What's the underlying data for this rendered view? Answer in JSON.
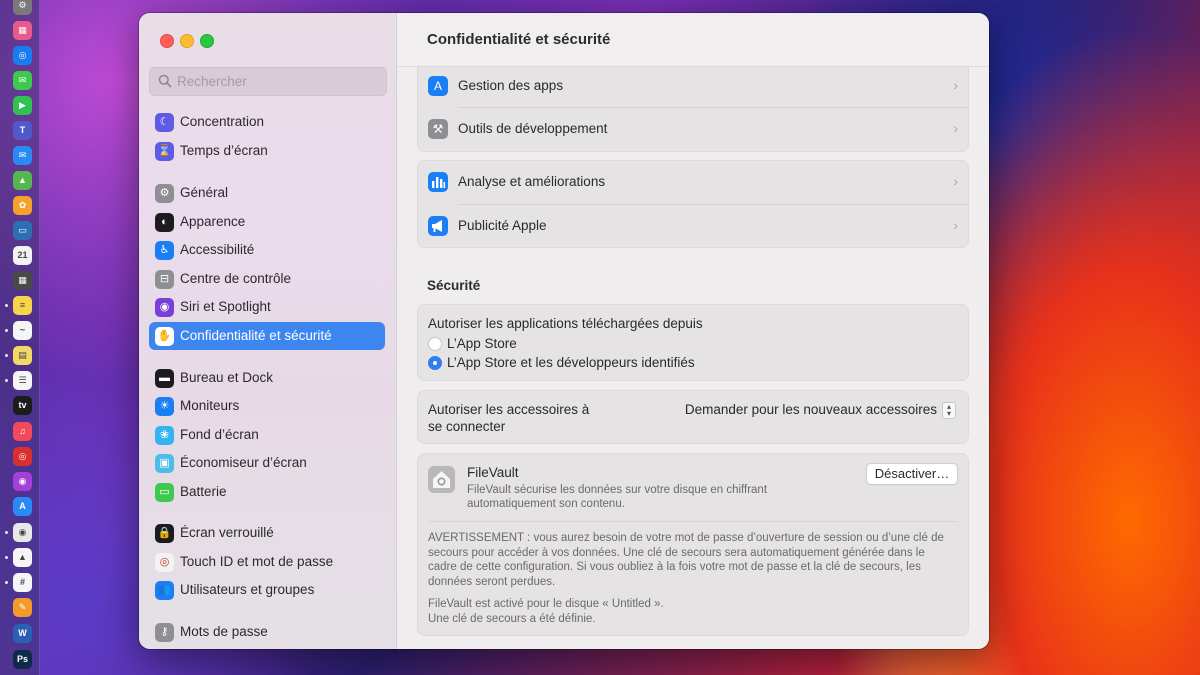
{
  "colors": {
    "accent": "#3d86f0",
    "close": "#ff5f57",
    "minimize": "#febc2e",
    "zoom": "#28c840"
  },
  "dock": {
    "icons": [
      {
        "name": "system-settings-icon",
        "glyph": "⚙",
        "color": "#7a7a7a"
      },
      {
        "name": "launchpad-icon",
        "glyph": "▦",
        "color": "#e85a8a"
      },
      {
        "name": "safari-icon",
        "glyph": "◎",
        "color": "#1b7cf2"
      },
      {
        "name": "messages-icon",
        "glyph": "✉",
        "color": "#3ec94e"
      },
      {
        "name": "facetime-icon",
        "glyph": "▶",
        "color": "#30c252"
      },
      {
        "name": "teams-icon",
        "glyph": "T",
        "color": "#5059c9"
      },
      {
        "name": "mail-icon",
        "glyph": "✉",
        "color": "#2a8af5"
      },
      {
        "name": "maps-icon",
        "glyph": "▲",
        "color": "#55b84f"
      },
      {
        "name": "photos-icon",
        "glyph": "✿",
        "color": "#f4a22b"
      },
      {
        "name": "preview-icon",
        "glyph": "▭",
        "color": "#2d6fb3"
      },
      {
        "name": "calendar-icon",
        "glyph": "21",
        "color": "#f2f2f2"
      },
      {
        "name": "calculator-icon",
        "glyph": "▦",
        "color": "#4a4a4a"
      },
      {
        "name": "notes-icon",
        "glyph": "≡",
        "color": "#f7d54a"
      },
      {
        "name": "freeform-icon",
        "glyph": "~",
        "color": "#f5f5f5"
      },
      {
        "name": "stickies-icon",
        "glyph": "▤",
        "color": "#f3d868"
      },
      {
        "name": "reminders-icon",
        "glyph": "☰",
        "color": "#f5f5f5"
      },
      {
        "name": "apple-tv-icon",
        "glyph": "tv",
        "color": "#1c1c1c"
      },
      {
        "name": "music-icon",
        "glyph": "♫",
        "color": "#f24a5c"
      },
      {
        "name": "creative-cloud-icon",
        "glyph": "◎",
        "color": "#da2f2f"
      },
      {
        "name": "podcasts-icon",
        "glyph": "◉",
        "color": "#a43fd8"
      },
      {
        "name": "app-store-icon",
        "glyph": "A",
        "color": "#2a8af5"
      },
      {
        "name": "chrome-icon",
        "glyph": "◉",
        "color": "#e8e8e8"
      },
      {
        "name": "google-drive-icon",
        "glyph": "▲",
        "color": "#f5f5f5"
      },
      {
        "name": "slack-icon",
        "glyph": "#",
        "color": "#f5f5f5"
      },
      {
        "name": "pages-icon",
        "glyph": "✎",
        "color": "#f39a2b"
      },
      {
        "name": "word-icon",
        "glyph": "W",
        "color": "#2b5fb4"
      },
      {
        "name": "photoshop-icon",
        "glyph": "Ps",
        "color": "#0f2a4a"
      }
    ]
  },
  "window": {
    "search_placeholder": "Rechercher",
    "title": "Confidentialité et sécurité"
  },
  "sidebar": {
    "items": [
      {
        "label": "Concentration",
        "icon": "moon-icon",
        "glyph": "☾",
        "color": "#5e5ce6"
      },
      {
        "label": "Temps d’écran",
        "icon": "hourglass-icon",
        "glyph": "⌛",
        "color": "#5e5ce6"
      },
      {
        "label": "Général",
        "icon": "gear-icon",
        "glyph": "⚙",
        "color": "#8e8e93"
      },
      {
        "label": "Apparence",
        "icon": "appearance-icon",
        "glyph": "◐",
        "color": "#1c1c1e"
      },
      {
        "label": "Accessibilité",
        "icon": "accessibility-icon",
        "glyph": "♿",
        "color": "#1a7ef5"
      },
      {
        "label": "Centre de contrôle",
        "icon": "control-center-icon",
        "glyph": "⊟",
        "color": "#8e8e93"
      },
      {
        "label": "Siri et Spotlight",
        "icon": "siri-icon",
        "glyph": "◉",
        "color": "#7a3fd8"
      },
      {
        "label": "Confidentialité et sécurité",
        "icon": "hand-icon",
        "glyph": "✋",
        "color": "#3d86f0"
      },
      {
        "label": "Bureau et Dock",
        "icon": "dock-icon",
        "glyph": "▬",
        "color": "#1c1c1e"
      },
      {
        "label": "Moniteurs",
        "icon": "brightness-icon",
        "glyph": "☀",
        "color": "#1a7ef5"
      },
      {
        "label": "Fond d’écran",
        "icon": "wallpaper-icon",
        "glyph": "❀",
        "color": "#33b3f0"
      },
      {
        "label": "Économiseur d’écran",
        "icon": "screensaver-icon",
        "glyph": "▣",
        "color": "#4bbde6"
      },
      {
        "label": "Batterie",
        "icon": "battery-icon",
        "glyph": "▭",
        "color": "#3ec94e"
      },
      {
        "label": "Écran verrouillé",
        "icon": "lock-icon",
        "glyph": "🔒",
        "color": "#1c1c1e"
      },
      {
        "label": "Touch ID et mot de passe",
        "icon": "fingerprint-icon",
        "glyph": "◎",
        "color": "#f2f2f2"
      },
      {
        "label": "Utilisateurs et groupes",
        "icon": "users-icon",
        "glyph": "👥",
        "color": "#1a7ef5"
      },
      {
        "label": "Mots de passe",
        "icon": "key-icon",
        "glyph": "⚷",
        "color": "#8e8e93"
      }
    ]
  },
  "main": {
    "group1": [
      {
        "label": "Gestion des apps",
        "icon": "app-store-icon",
        "glyph": "A",
        "color": "#1a7ef5"
      },
      {
        "label": "Outils de développement",
        "icon": "hammer-icon",
        "glyph": "⚒",
        "color": "#8e8e93"
      }
    ],
    "group2": [
      {
        "label": "Analyse et améliorations",
        "icon": "chart-icon",
        "glyph": "▮",
        "color": "#1a7ef5"
      },
      {
        "label": "Publicité Apple",
        "icon": "megaphone-icon",
        "glyph": "📢",
        "color": "#1a7ef5"
      }
    ],
    "security": {
      "section_title": "Sécurité",
      "download_label": "Autoriser les applications téléchargées depuis",
      "option1": "L’App Store",
      "option2": "L’App Store et les développeurs identifiés",
      "selected_option": "L’App Store et les développeurs identifiés",
      "accessories_label_line1": "Autoriser les accessoires à",
      "accessories_label_line2": "se connecter",
      "accessories_value": "Demander pour les nouveaux accessoires",
      "filevault_title": "FileVault",
      "filevault_desc_line1": "FileVault sécurise les données sur votre disque en chiffrant",
      "filevault_desc_line2": "automatiquement son contenu.",
      "filevault_button": "Désactiver…",
      "warning_line1": "AVERTISSEMENT : vous aurez besoin de votre mot de passe d’ouverture de session ou d’une clé de",
      "warning_line2": "secours pour accéder à vos données. Une clé de secours sera automatiquement générée dans le",
      "warning_line3": "cadre de cette configuration. Si vous oubliez à la fois votre mot de passe et la clé de secours, les",
      "warning_line4": "données seront perdues.",
      "status_line1": "FileVault est activé pour le disque « Untitled ».",
      "status_line2": "Une clé de secours a été définie."
    }
  }
}
